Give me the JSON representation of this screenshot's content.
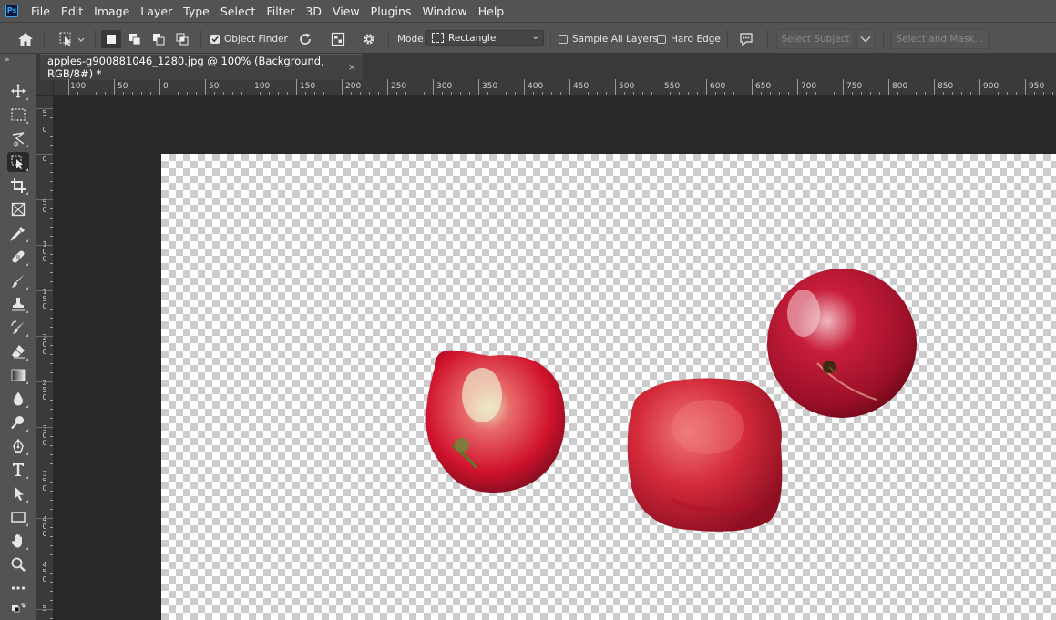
{
  "app": {
    "logo": "Ps"
  },
  "menu": [
    "File",
    "Edit",
    "Image",
    "Layer",
    "Type",
    "Select",
    "Filter",
    "3D",
    "View",
    "Plugins",
    "Window",
    "Help"
  ],
  "options": {
    "object_finder_label": "Object Finder",
    "object_finder_checked": true,
    "mode_label": "Mode:",
    "mode_value": "Rectangle",
    "sample_all_layers_label": "Sample All Layers",
    "sample_all_layers_checked": false,
    "hard_edge_label": "Hard Edge",
    "hard_edge_checked": false,
    "select_subject_label": "Select Subject",
    "select_and_mask_label": "Select and Mask..."
  },
  "document_tab": {
    "title": "apples-g900881046_1280.jpg @ 100% (Background, RGB/8#) *",
    "close_glyph": "×"
  },
  "ruler": {
    "horizontal_labels": [
      "100",
      "50",
      "0",
      "50",
      "100",
      "150",
      "200",
      "250",
      "300",
      "350",
      "400",
      "450",
      "500",
      "550",
      "600",
      "650",
      "700",
      "750",
      "800",
      "850",
      "900",
      "950"
    ],
    "vertical_labels": [
      "5",
      "0",
      "0",
      "5 0",
      "1 0 0",
      "1 5 0",
      "2 0 0",
      "2 5 0",
      "3 0 0",
      "3 5 0",
      "4 0 0",
      "4 5 0",
      "5"
    ]
  },
  "tools": [
    "move-tool",
    "marquee-tool",
    "lasso-tool",
    "object-selection-tool",
    "crop-tool",
    "frame-tool",
    "eyedropper-tool",
    "healing-brush-tool",
    "brush-tool",
    "clone-stamp-tool",
    "history-brush-tool",
    "eraser-tool",
    "gradient-tool",
    "blur-tool",
    "dodge-tool",
    "pen-tool",
    "type-tool",
    "path-selection-tool",
    "rectangle-tool",
    "hand-tool",
    "zoom-tool",
    "edit-toolbar",
    "swap-colors"
  ],
  "colors": {
    "menubar_bg": "#535353",
    "workspace_bg": "#282828",
    "apple_red": "#c8102e",
    "apple_dark": "#7a0d1f",
    "apple_highlight": "#e8e2b8"
  }
}
